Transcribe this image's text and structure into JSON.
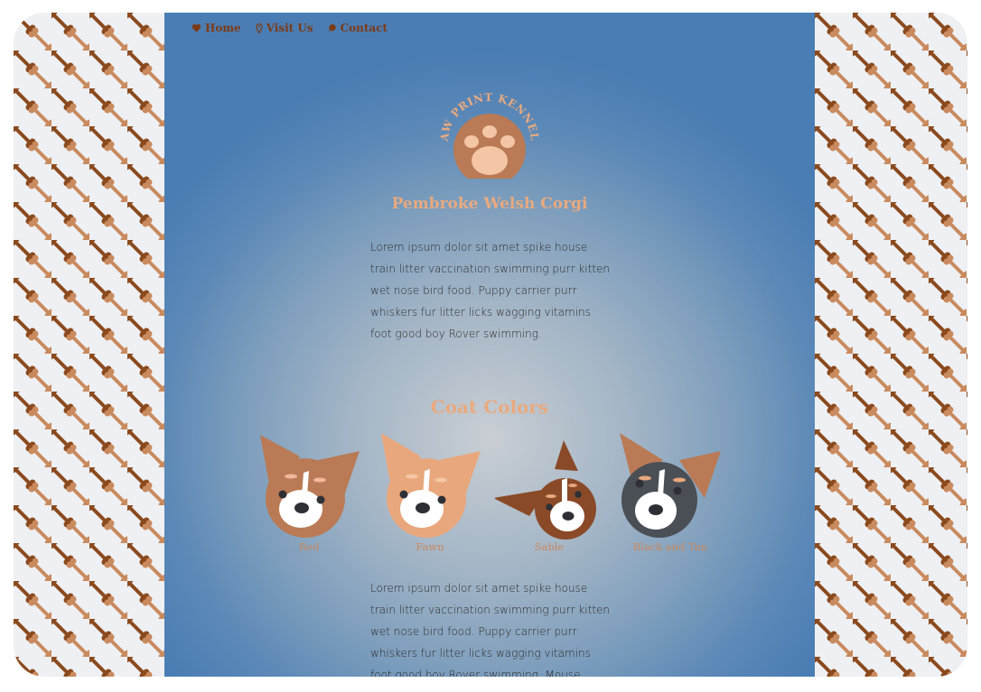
{
  "nav": {
    "items": [
      {
        "label": "Home",
        "icon": "heart-icon"
      },
      {
        "label": "Visit Us",
        "icon": "location-pin-icon"
      },
      {
        "label": "Contact",
        "icon": "speech-bubble-icon"
      }
    ]
  },
  "logo": {
    "text": "PAW PRINT KENNELS"
  },
  "breed": {
    "title": "Pembroke Welsh Corgi"
  },
  "intro": "Lorem ipsum dolor sit amet spike house train litter vaccination swimming purr kitten wet nose bird food. Puppy carrier purr whiskers fur litter licks wagging vitamins foot good boy Rover swimming.",
  "coat": {
    "title": "Coat Colors",
    "colors": [
      {
        "label": "Red"
      },
      {
        "label": "Fawn"
      },
      {
        "label": "Sable"
      },
      {
        "label": "Black and Tan"
      }
    ]
  },
  "body_text": "Lorem ipsum dolor sit amet spike house train litter vaccination swimming purr kitten wet nose bird food. Puppy carrier purr whiskers fur litter licks wagging vitamins foot good boy Rover swimming. Mouse swimming small",
  "colors": {
    "accent": "#e9aa7f",
    "nav": "#7d3a14",
    "bg_blue": "#4a7db4"
  }
}
